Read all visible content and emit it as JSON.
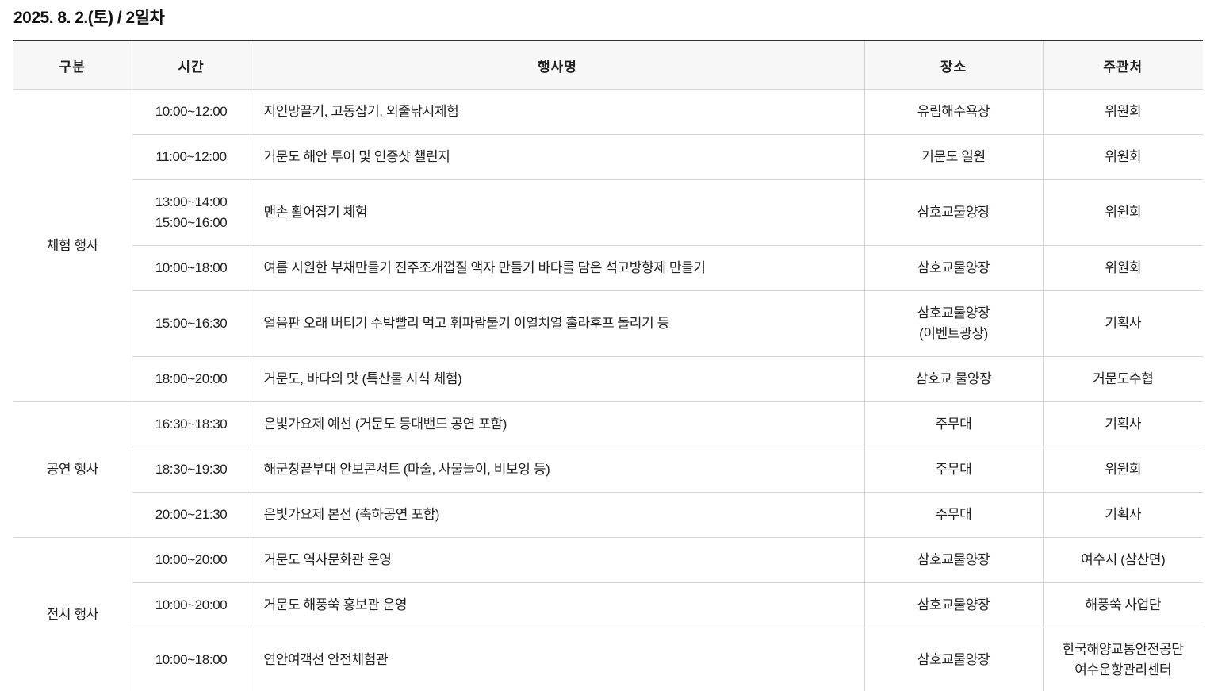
{
  "title": "2025. 8. 2.(토) / 2일차",
  "headers": {
    "category": "구분",
    "time": "시간",
    "event": "행사명",
    "place": "장소",
    "host": "주관처"
  },
  "groups": [
    {
      "category": "체험 행사",
      "rows": [
        {
          "time": [
            "10:00~12:00"
          ],
          "event": "지인망끌기, 고동잡기, 외줄낚시체험",
          "place": [
            "유림해수욕장"
          ],
          "host": [
            "위원회"
          ]
        },
        {
          "time": [
            "11:00~12:00"
          ],
          "event": "거문도 해안 투어 및 인증샷 챌린지",
          "place": [
            "거문도 일원"
          ],
          "host": [
            "위원회"
          ]
        },
        {
          "time": [
            "13:00~14:00",
            "15:00~16:00"
          ],
          "event": "맨손 활어잡기 체험",
          "place": [
            "삼호교물양장"
          ],
          "host": [
            "위원회"
          ]
        },
        {
          "time": [
            "10:00~18:00"
          ],
          "event": "여름 시원한 부채만들기 진주조개껍질 액자 만들기 바다를 담은 석고방향제 만들기",
          "place": [
            "삼호교물양장"
          ],
          "host": [
            "위원회"
          ]
        },
        {
          "time": [
            "15:00~16:30"
          ],
          "event": "얼음판 오래 버티기 수박빨리 먹고 휘파람불기 이열치열 훌라후프 돌리기 등",
          "place": [
            "삼호교물양장",
            "(이벤트광장)"
          ],
          "host": [
            "기획사"
          ]
        },
        {
          "time": [
            "18:00~20:00"
          ],
          "event": "거문도, 바다의 맛 (특산물 시식 체험)",
          "place": [
            "삼호교 물양장"
          ],
          "host": [
            "거문도수협"
          ]
        }
      ]
    },
    {
      "category": "공연 행사",
      "rows": [
        {
          "time": [
            "16:30~18:30"
          ],
          "event": "은빛가요제 예선 (거문도 등대밴드 공연 포함)",
          "place": [
            "주무대"
          ],
          "host": [
            "기획사"
          ]
        },
        {
          "time": [
            "18:30~19:30"
          ],
          "event": "해군창끝부대 안보콘서트 (마술, 사물놀이, 비보잉 등)",
          "place": [
            "주무대"
          ],
          "host": [
            "위원회"
          ]
        },
        {
          "time": [
            "20:00~21:30"
          ],
          "event": "은빛가요제 본선 (축하공연 포함)",
          "place": [
            "주무대"
          ],
          "host": [
            "기획사"
          ]
        }
      ]
    },
    {
      "category": "전시 행사",
      "rows": [
        {
          "time": [
            "10:00~20:00"
          ],
          "event": "거문도 역사문화관 운영",
          "place": [
            "삼호교물양장"
          ],
          "host": [
            "여수시 (삼산면)"
          ]
        },
        {
          "time": [
            "10:00~20:00"
          ],
          "event": "거문도 해풍쑥 홍보관 운영",
          "place": [
            "삼호교물양장"
          ],
          "host": [
            "해풍쑥 사업단"
          ]
        },
        {
          "time": [
            "10:00~18:00"
          ],
          "event": "연안여객선 안전체험관",
          "place": [
            "삼호교물양장"
          ],
          "host": [
            "한국해양교통안전공단",
            "여수운항관리센터"
          ]
        }
      ]
    }
  ]
}
